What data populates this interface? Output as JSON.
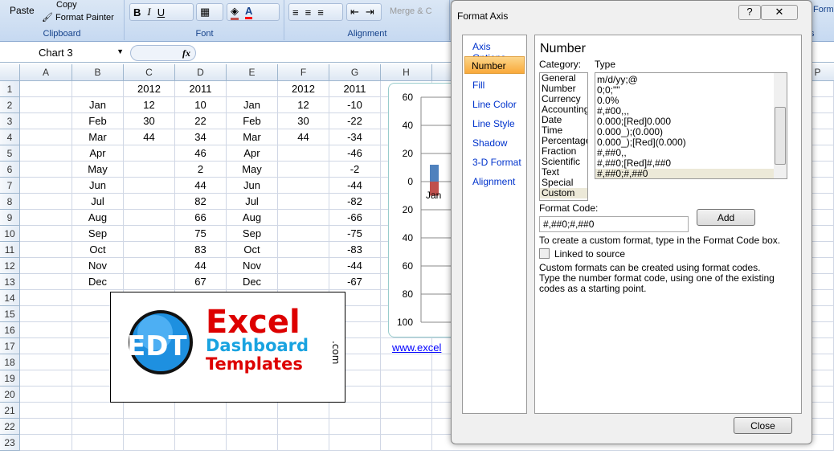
{
  "ribbon": {
    "paste": "Paste",
    "copy": "Copy",
    "format_painter": "Format Painter",
    "clipboard": "Clipboard",
    "font": "Font",
    "alignment": "Alignment",
    "merge": "Merge & C",
    "bold": "B",
    "italic": "I",
    "underline": "U",
    "right_partial": "te",
    "format_partial": "Form",
    "styles_partial": "s"
  },
  "formula_bar": {
    "name_box": "Chart 3",
    "fx": "fx",
    "value": ""
  },
  "columns": [
    "A",
    "B",
    "C",
    "D",
    "E",
    "F",
    "G",
    "H",
    "P"
  ],
  "rows": [
    "1",
    "2",
    "3",
    "4",
    "5",
    "6",
    "7",
    "8",
    "9",
    "10",
    "11",
    "12",
    "13",
    "14",
    "15",
    "16",
    "17",
    "18",
    "19",
    "20",
    "21",
    "22",
    "23"
  ],
  "table": [
    [
      "",
      "",
      "2012",
      "2011",
      "",
      "2012",
      "2011"
    ],
    [
      "",
      "Jan",
      "12",
      "10",
      "Jan",
      "12",
      "-10"
    ],
    [
      "",
      "Feb",
      "30",
      "22",
      "Feb",
      "30",
      "-22"
    ],
    [
      "",
      "Mar",
      "44",
      "34",
      "Mar",
      "44",
      "-34"
    ],
    [
      "",
      "Apr",
      "",
      "46",
      "Apr",
      "",
      "-46"
    ],
    [
      "",
      "May",
      "",
      "2",
      "May",
      "",
      "-2"
    ],
    [
      "",
      "Jun",
      "",
      "44",
      "Jun",
      "",
      "-44"
    ],
    [
      "",
      "Jul",
      "",
      "82",
      "Jul",
      "",
      "-82"
    ],
    [
      "",
      "Aug",
      "",
      "66",
      "Aug",
      "",
      "-66"
    ],
    [
      "",
      "Sep",
      "",
      "75",
      "Sep",
      "",
      "-75"
    ],
    [
      "",
      "Oct",
      "",
      "83",
      "Oct",
      "",
      "-83"
    ],
    [
      "",
      "Nov",
      "",
      "44",
      "Nov",
      "",
      "-44"
    ],
    [
      "",
      "Dec",
      "",
      "67",
      "Dec",
      "",
      "-67"
    ]
  ],
  "chart": {
    "ticks": [
      "60",
      "40",
      "20",
      "0",
      "20",
      "40",
      "60",
      "80",
      "100"
    ],
    "category": "Jan",
    "series_colors": [
      "#4f81bd",
      "#c0504d"
    ]
  },
  "link": "www.excel",
  "logo": {
    "text": [
      "Excel",
      "Dashboard",
      "Templates",
      ".com"
    ],
    "initials": "EDT"
  },
  "dialog": {
    "title": "Format Axis",
    "help": "?",
    "close_x": "✕",
    "nav": [
      "Axis Options",
      "Number",
      "Fill",
      "Line Color",
      "Line Style",
      "Shadow",
      "3-D Format",
      "Alignment"
    ],
    "selected_nav": "Number",
    "heading": "Number",
    "category_label": "Category:",
    "type_label": "Type",
    "categories": [
      "General",
      "Number",
      "Currency",
      "Accounting",
      "Date",
      "Time",
      "Percentage",
      "Fraction",
      "Scientific",
      "Text",
      "Special",
      "Custom"
    ],
    "selected_category": "Custom",
    "types": [
      "m/d/yy;@",
      "0;0;\"\"",
      "0.0%",
      "#,#00,,,",
      "0.000;[Red]0.000",
      "0.000_);(0.000)",
      "0.000_);[Red](0.000)",
      "#,##0,,",
      "#,##0;[Red]#,##0",
      "#,##0;#,##0"
    ],
    "selected_type": "#,##0;#,##0",
    "format_code_label": "Format Code:",
    "format_code": "#,##0;#,##0",
    "add": "Add",
    "hint": "To create a custom format, type in the Format Code box.",
    "linked": "Linked to source",
    "linked_checked": false,
    "desc": "Custom formats can be created using format codes.  Type the number format code, using one of the existing codes as a starting point.",
    "close": "Close"
  }
}
